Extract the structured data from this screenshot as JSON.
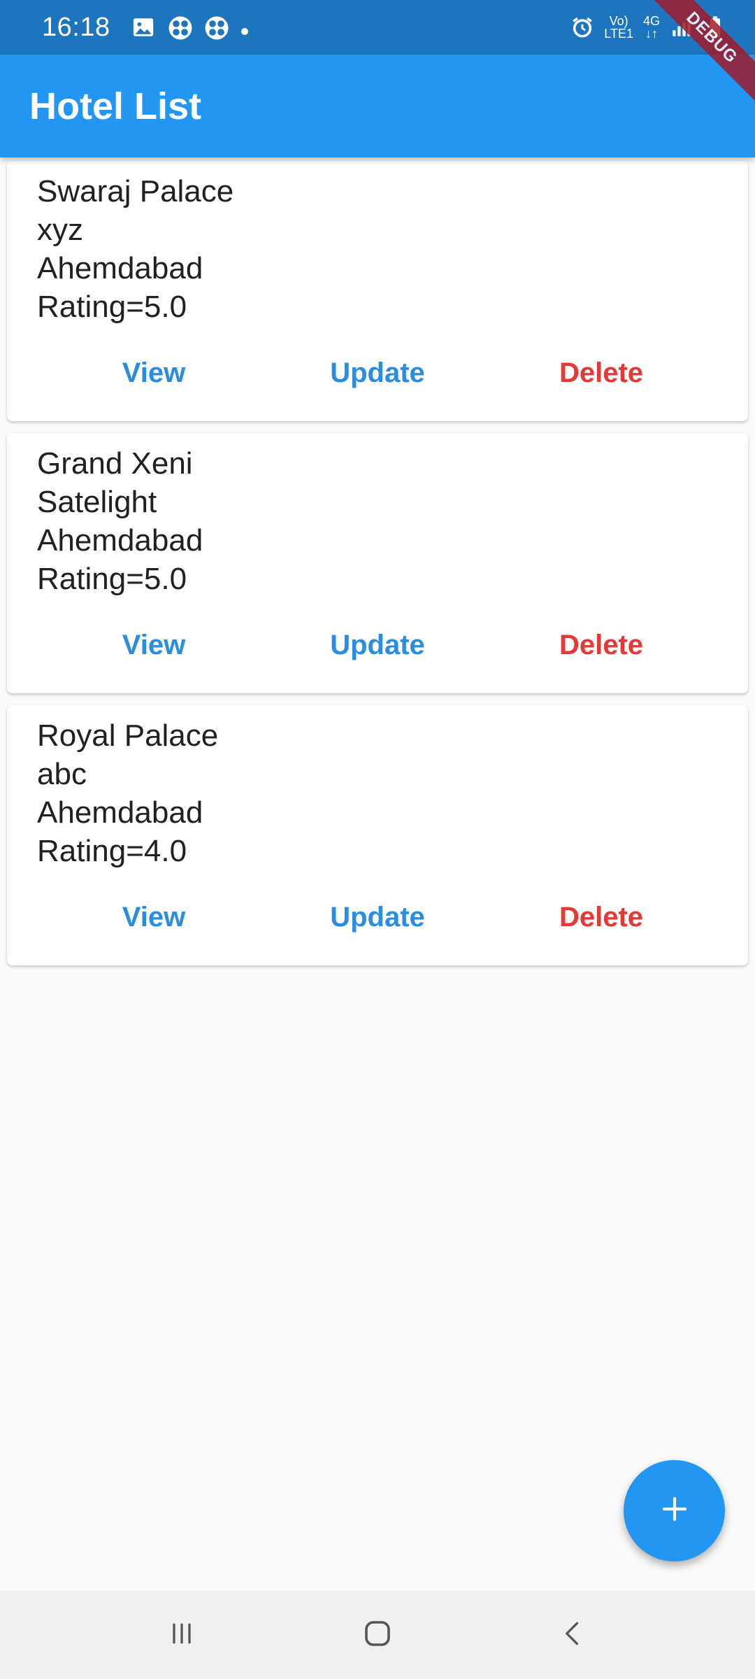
{
  "status_bar": {
    "time": "16:18",
    "left_icons": [
      "image-icon",
      "fan-icon",
      "fan-icon",
      "dot-icon"
    ],
    "right_icons": [
      "alarm-icon",
      "volte-icon",
      "4g-icon",
      "signal-icon",
      "battery-icon"
    ],
    "volte_top": "Vo)",
    "volte_bottom": "LTE1",
    "net_type": "4G"
  },
  "debug_banner": "DEBUG",
  "app_bar": {
    "title": "Hotel List"
  },
  "hotels": [
    {
      "name": "Swaraj Palace",
      "address": "xyz",
      "city": "Ahemdabad",
      "rating": "Rating=5.0"
    },
    {
      "name": "Grand Xeni",
      "address": "Satelight",
      "city": "Ahemdabad",
      "rating": "Rating=5.0"
    },
    {
      "name": "Royal Palace",
      "address": "abc",
      "city": "Ahemdabad",
      "rating": "Rating=4.0"
    }
  ],
  "actions": {
    "view": "View",
    "update": "Update",
    "delete": "Delete"
  },
  "fab": {
    "icon": "plus-icon"
  },
  "nav_bar": {
    "icons": [
      "recents-icon",
      "home-icon",
      "back-icon"
    ]
  },
  "colors": {
    "status_bar": "#1d75bd",
    "app_bar": "#2196f3",
    "action_primary": "#2a8de0",
    "action_delete": "#e53935",
    "background": "#fafafa"
  }
}
